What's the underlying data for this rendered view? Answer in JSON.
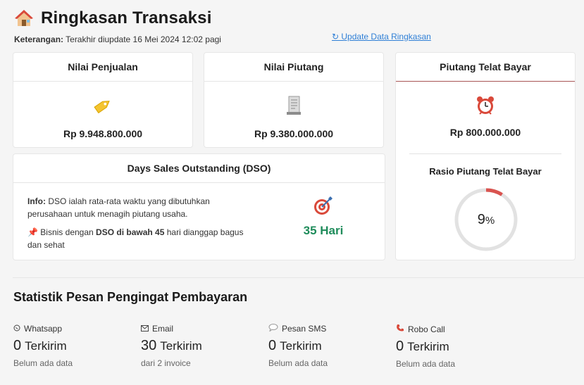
{
  "header": {
    "title": "Ringkasan Transaksi",
    "icon": "house-icon",
    "note_label": "Keterangan:",
    "note_text": "Terakhir diupdate 16 Mei 2024 12:02 pagi",
    "update_label": "↻ Update Data Ringkasan"
  },
  "cards": {
    "sales": {
      "title": "Nilai Penjualan",
      "value": "Rp 9.948.800.000",
      "icon": "price-tag-icon"
    },
    "receivable": {
      "title": "Nilai Piutang",
      "value": "Rp 9.380.000.000",
      "icon": "receipt-icon"
    },
    "overdue": {
      "title": "Piutang Telat Bayar",
      "value": "Rp 800.000.000",
      "icon": "alarm-clock-icon",
      "ratio_title": "Rasio Piutang Telat Bayar",
      "ratio_num": "9",
      "ratio_unit": "%",
      "ratio_fraction": 0.09
    }
  },
  "dso": {
    "title": "Days Sales Outstanding (DSO)",
    "info_label": "Info:",
    "info_text": "DSO ialah rata-rata waktu yang dibutuhkan perusahaan untuk menagih piutang usaha.",
    "note_pre": "Bisnis dengan ",
    "note_bold": "DSO di bawah 45",
    "note_post": " hari dianggap bagus dan sehat",
    "days": "35 Hari",
    "icon": "target-icon"
  },
  "stats": {
    "title": "Statistik Pesan Pengingat Pembayaran",
    "items": [
      {
        "label": "Whatsapp",
        "num": "0",
        "unit": "Terkirim",
        "note": "Belum ada data",
        "icon": "whatsapp-icon"
      },
      {
        "label": "Email",
        "num": "30",
        "unit": "Terkirim",
        "note": "dari 2 invoice",
        "icon": "envelope-icon"
      },
      {
        "label": "Pesan SMS",
        "num": "0",
        "unit": "Terkirim",
        "note": "Belum ada data",
        "icon": "speech-bubble-icon"
      },
      {
        "label": "Robo Call",
        "num": "0",
        "unit": "Terkirim",
        "note": "Belum ada data",
        "icon": "phone-icon"
      }
    ]
  },
  "colors": {
    "accent": "#2f7fd6",
    "good": "#1f8c5b",
    "gauge": "#d9534f"
  }
}
